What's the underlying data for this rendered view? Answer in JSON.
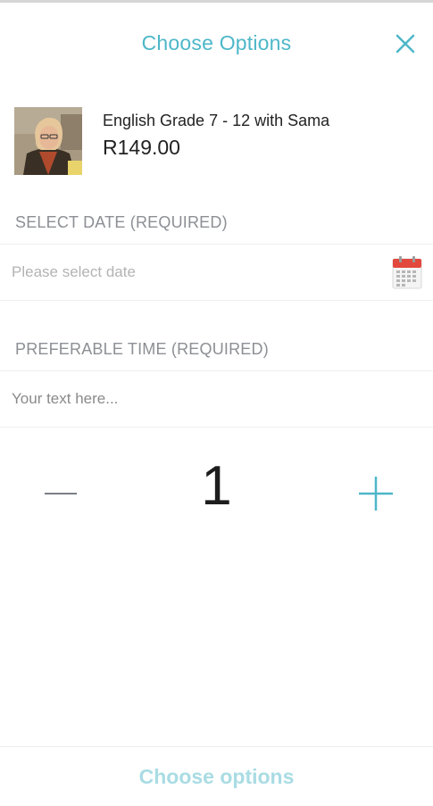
{
  "header": {
    "title": "Choose Options",
    "close_icon": "close-icon"
  },
  "product": {
    "name": "English Grade 7 - 12 with Sama",
    "price": "R149.00"
  },
  "date_section": {
    "label": "SELECT DATE (REQUIRED)",
    "placeholder": "Please select date",
    "icon": "calendar-icon"
  },
  "time_section": {
    "label": "PREFERABLE TIME (REQUIRED)",
    "placeholder": "Your text here..."
  },
  "quantity": {
    "value": "1",
    "minus_icon": "minus-icon",
    "plus_icon": "plus-icon"
  },
  "footer": {
    "button_label": "Choose options"
  },
  "colors": {
    "accent": "#4db7c8",
    "accent_light": "#a9dce4",
    "label_gray": "#8c8f94",
    "calendar_red": "#e2483d"
  }
}
